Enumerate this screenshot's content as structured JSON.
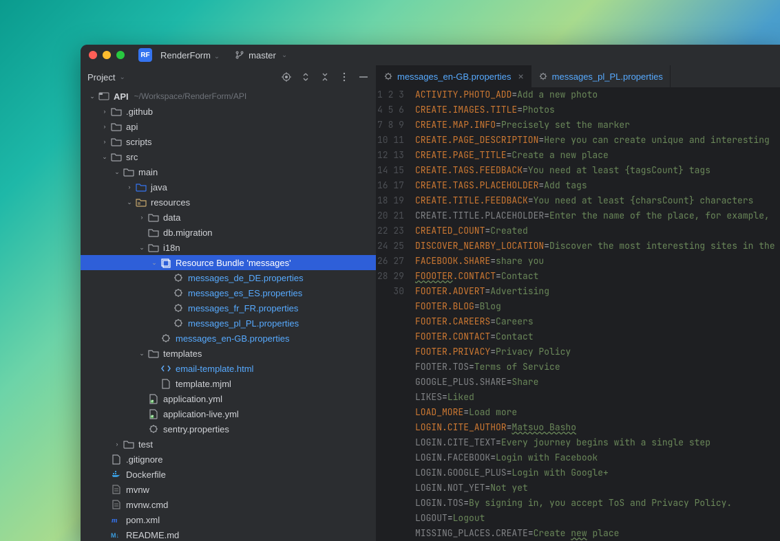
{
  "project_badge": "RF",
  "project_name": "RenderForm",
  "branch": "master",
  "panel_title": "Project",
  "root_name": "API",
  "root_path": "~/Workspace/RenderForm/API",
  "tabs": [
    {
      "label": "messages_en-GB.properties",
      "active": true
    },
    {
      "label": "messages_pl_PL.properties",
      "active": false
    }
  ],
  "tree": [
    {
      "depth": 0,
      "chev": "open",
      "icon": "project",
      "label": "API",
      "suffix": "~/Workspace/RenderForm/API",
      "bold": true
    },
    {
      "depth": 1,
      "chev": "closed",
      "icon": "folder",
      "label": ".github"
    },
    {
      "depth": 1,
      "chev": "closed",
      "icon": "folder",
      "label": "api"
    },
    {
      "depth": 1,
      "chev": "closed",
      "icon": "folder",
      "label": "scripts"
    },
    {
      "depth": 1,
      "chev": "open",
      "icon": "folder",
      "label": "src"
    },
    {
      "depth": 2,
      "chev": "open",
      "icon": "folder",
      "label": "main"
    },
    {
      "depth": 3,
      "chev": "closed",
      "icon": "src-folder",
      "label": "java"
    },
    {
      "depth": 3,
      "chev": "open",
      "icon": "res-folder",
      "label": "resources"
    },
    {
      "depth": 4,
      "chev": "closed",
      "icon": "folder",
      "label": "data"
    },
    {
      "depth": 4,
      "chev": "none",
      "icon": "folder",
      "label": "db.migration"
    },
    {
      "depth": 4,
      "chev": "open",
      "icon": "folder",
      "label": "i18n"
    },
    {
      "depth": 5,
      "chev": "open",
      "icon": "bundle",
      "label": "Resource Bundle 'messages'",
      "selected": true
    },
    {
      "depth": 6,
      "chev": "none",
      "icon": "props",
      "label": "messages_de_DE.properties",
      "link": true
    },
    {
      "depth": 6,
      "chev": "none",
      "icon": "props",
      "label": "messages_es_ES.properties",
      "link": true
    },
    {
      "depth": 6,
      "chev": "none",
      "icon": "props",
      "label": "messages_fr_FR.properties",
      "link": true
    },
    {
      "depth": 6,
      "chev": "none",
      "icon": "props",
      "label": "messages_pl_PL.properties",
      "link": true
    },
    {
      "depth": 5,
      "chev": "none",
      "icon": "props",
      "label": "messages_en-GB.properties",
      "link": true
    },
    {
      "depth": 4,
      "chev": "open",
      "icon": "folder",
      "label": "templates"
    },
    {
      "depth": 5,
      "chev": "none",
      "icon": "html",
      "label": "email-template.html",
      "link": true
    },
    {
      "depth": 5,
      "chev": "none",
      "icon": "file",
      "label": "template.mjml"
    },
    {
      "depth": 4,
      "chev": "none",
      "icon": "yml",
      "label": "application.yml"
    },
    {
      "depth": 4,
      "chev": "none",
      "icon": "yml",
      "label": "application-live.yml"
    },
    {
      "depth": 4,
      "chev": "none",
      "icon": "props",
      "label": "sentry.properties"
    },
    {
      "depth": 2,
      "chev": "closed",
      "icon": "folder",
      "label": "test"
    },
    {
      "depth": 1,
      "chev": "none",
      "icon": "file",
      "label": ".gitignore"
    },
    {
      "depth": 1,
      "chev": "none",
      "icon": "docker",
      "label": "Dockerfile"
    },
    {
      "depth": 1,
      "chev": "none",
      "icon": "file-gray",
      "label": "mvnw"
    },
    {
      "depth": 1,
      "chev": "none",
      "icon": "file-gray",
      "label": "mvnw.cmd"
    },
    {
      "depth": 1,
      "chev": "none",
      "icon": "maven",
      "label": "pom.xml"
    },
    {
      "depth": 1,
      "chev": "none",
      "icon": "md",
      "label": "README.md"
    }
  ],
  "code_lines": [
    {
      "n": 1,
      "key": "ACTIVITY.PHOTO_ADD",
      "val": "Add a new photo",
      "vclass": "v"
    },
    {
      "n": 2,
      "key": "CREATE.IMAGES.TITLE",
      "val": "Photos",
      "vclass": "v"
    },
    {
      "n": 3,
      "key": "CREATE.MAP.INFO",
      "val": "Precisely set the marker",
      "vclass": "v"
    },
    {
      "n": 4,
      "key": "CREATE.PAGE_DESCRIPTION",
      "val": "Here you can create unique and interesting ",
      "vclass": "v"
    },
    {
      "n": 5,
      "key": "CREATE.PAGE_TITLE",
      "val": "Create a new place",
      "vclass": "v"
    },
    {
      "n": 6,
      "key": "CREATE.TAGS.FEEDBACK",
      "val": "You need at least {tagsCount} tags",
      "vclass": "v"
    },
    {
      "n": 7,
      "key": "CREATE.TAGS.PLACEHOLDER",
      "val": "Add tags",
      "vclass": "v"
    },
    {
      "n": 8,
      "key": "CREATE.TITLE.FEEDBACK",
      "val": "You need at least {charsCount} characters",
      "vclass": "v"
    },
    {
      "n": 9,
      "key": "CREATE.TITLE.PLACEHOLDER",
      "val": "Enter the name of the place, for example, ",
      "vclass": "v",
      "kmuted": true
    },
    {
      "n": 10,
      "key": "CREATED_COUNT",
      "val": "Created",
      "vclass": "v"
    },
    {
      "n": 11,
      "key": "DISCOVER_NEARBY_LOCATION",
      "val": "Discover the most interesting sites in the",
      "vclass": "v"
    },
    {
      "n": 12,
      "key": "FACEBOOK.SHARE",
      "val": "share you",
      "vclass": "v"
    },
    {
      "n": 13,
      "key_parts": [
        {
          "t": "FOOOTER",
          "spell": true
        },
        {
          "t": ".CONTACT"
        }
      ],
      "val": "Contact",
      "vclass": "v"
    },
    {
      "n": 14,
      "key": "FOOTER.ADVERT",
      "val": "Advertising",
      "vclass": "v"
    },
    {
      "n": 15,
      "key": "FOOTER.BLOG",
      "val": "Blog",
      "vclass": "v"
    },
    {
      "n": 16,
      "key": "FOOTER.CAREERS",
      "val": "Careers",
      "vclass": "v"
    },
    {
      "n": 17,
      "key": "FOOTER.CONTACT",
      "val": "Contact",
      "vclass": "v"
    },
    {
      "n": 18,
      "key": "FOOTER.PRIVACY",
      "val": "Privacy Policy",
      "vclass": "v"
    },
    {
      "n": 19,
      "key": "FOOTER.TOS",
      "val": "Terms of Service",
      "vclass": "v",
      "kmuted": true
    },
    {
      "n": 20,
      "key": "GOOGLE_PLUS.SHARE",
      "val": "Share",
      "vclass": "v",
      "kmuted": true
    },
    {
      "n": 21,
      "key": "LIKES",
      "val": "Liked",
      "vclass": "v",
      "kmuted": true
    },
    {
      "n": 22,
      "key": "LOAD_MORE",
      "val": "Load more",
      "vclass": "v"
    },
    {
      "n": 23,
      "key": "LOGIN.CITE_AUTHOR",
      "val_parts": [
        {
          "t": "Matsuo Basho",
          "spell": true
        }
      ],
      "vclass": "v"
    },
    {
      "n": 24,
      "key": "LOGIN.CITE_TEXT",
      "val": "Every journey begins with a single step",
      "vclass": "v",
      "kmuted": true
    },
    {
      "n": 25,
      "key": "LOGIN.FACEBOOK",
      "val": "Login with Facebook",
      "vclass": "v",
      "kmuted": true
    },
    {
      "n": 26,
      "key": "LOGIN.GOOGLE_PLUS",
      "val": "Login with Google+",
      "vclass": "v",
      "kmuted": true
    },
    {
      "n": 27,
      "key": "LOGIN.NOT_YET",
      "val": "Not yet",
      "vclass": "v",
      "kmuted": true
    },
    {
      "n": 28,
      "key": "LOGIN.TOS",
      "val": "By signing in, you accept ToS and Privacy Policy.",
      "vclass": "v",
      "kmuted": true
    },
    {
      "n": 29,
      "key": "LOGOUT",
      "val": "Logout",
      "vclass": "v",
      "kmuted": true
    },
    {
      "n": 30,
      "key": "MISSING_PLACES.CREATE",
      "val_parts": [
        {
          "t": "Create "
        },
        {
          "t": "new",
          "spell": true
        },
        {
          "t": " place"
        }
      ],
      "vclass": "v",
      "kmuted": true
    }
  ]
}
